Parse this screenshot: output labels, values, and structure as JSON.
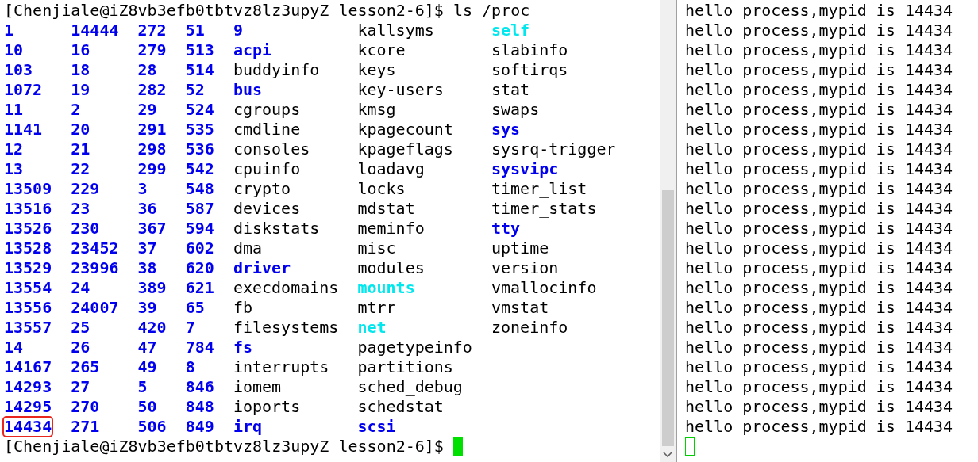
{
  "left_terminal": {
    "command_line": "[Chenjiale@iZ8vb3efb0tbtvz8lz3upyZ lesson2-6]$ ls /proc",
    "columns": [
      {
        "entries": [
          {
            "name": "1",
            "kind": "dir",
            "boxed": false
          },
          {
            "name": "10",
            "kind": "dir",
            "boxed": false
          },
          {
            "name": "103",
            "kind": "dir",
            "boxed": false
          },
          {
            "name": "1072",
            "kind": "dir",
            "boxed": false
          },
          {
            "name": "11",
            "kind": "dir",
            "boxed": false
          },
          {
            "name": "1141",
            "kind": "dir",
            "boxed": false
          },
          {
            "name": "12",
            "kind": "dir",
            "boxed": false
          },
          {
            "name": "13",
            "kind": "dir",
            "boxed": false
          },
          {
            "name": "13509",
            "kind": "dir",
            "boxed": false
          },
          {
            "name": "13516",
            "kind": "dir",
            "boxed": false
          },
          {
            "name": "13526",
            "kind": "dir",
            "boxed": false
          },
          {
            "name": "13528",
            "kind": "dir",
            "boxed": false
          },
          {
            "name": "13529",
            "kind": "dir",
            "boxed": false
          },
          {
            "name": "13554",
            "kind": "dir",
            "boxed": false
          },
          {
            "name": "13556",
            "kind": "dir",
            "boxed": false
          },
          {
            "name": "13557",
            "kind": "dir",
            "boxed": false
          },
          {
            "name": "14",
            "kind": "dir",
            "boxed": false
          },
          {
            "name": "14167",
            "kind": "dir",
            "boxed": false
          },
          {
            "name": "14293",
            "kind": "dir",
            "boxed": false
          },
          {
            "name": "14295",
            "kind": "dir",
            "boxed": false
          },
          {
            "name": "14434",
            "kind": "dir",
            "boxed": true
          }
        ]
      },
      {
        "entries": [
          {
            "name": "14444",
            "kind": "dir"
          },
          {
            "name": "16",
            "kind": "dir"
          },
          {
            "name": "18",
            "kind": "dir"
          },
          {
            "name": "19",
            "kind": "dir"
          },
          {
            "name": "2",
            "kind": "dir"
          },
          {
            "name": "20",
            "kind": "dir"
          },
          {
            "name": "21",
            "kind": "dir"
          },
          {
            "name": "22",
            "kind": "dir"
          },
          {
            "name": "229",
            "kind": "dir"
          },
          {
            "name": "23",
            "kind": "dir"
          },
          {
            "name": "230",
            "kind": "dir"
          },
          {
            "name": "23452",
            "kind": "dir"
          },
          {
            "name": "23996",
            "kind": "dir"
          },
          {
            "name": "24",
            "kind": "dir"
          },
          {
            "name": "24007",
            "kind": "dir"
          },
          {
            "name": "25",
            "kind": "dir"
          },
          {
            "name": "26",
            "kind": "dir"
          },
          {
            "name": "265",
            "kind": "dir"
          },
          {
            "name": "27",
            "kind": "dir"
          },
          {
            "name": "270",
            "kind": "dir"
          },
          {
            "name": "271",
            "kind": "dir"
          }
        ]
      },
      {
        "entries": [
          {
            "name": "272",
            "kind": "dir"
          },
          {
            "name": "279",
            "kind": "dir"
          },
          {
            "name": "28",
            "kind": "dir"
          },
          {
            "name": "282",
            "kind": "dir"
          },
          {
            "name": "29",
            "kind": "dir"
          },
          {
            "name": "291",
            "kind": "dir"
          },
          {
            "name": "298",
            "kind": "dir"
          },
          {
            "name": "299",
            "kind": "dir"
          },
          {
            "name": "3",
            "kind": "dir"
          },
          {
            "name": "36",
            "kind": "dir"
          },
          {
            "name": "367",
            "kind": "dir"
          },
          {
            "name": "37",
            "kind": "dir"
          },
          {
            "name": "38",
            "kind": "dir"
          },
          {
            "name": "389",
            "kind": "dir"
          },
          {
            "name": "39",
            "kind": "dir"
          },
          {
            "name": "420",
            "kind": "dir"
          },
          {
            "name": "47",
            "kind": "dir"
          },
          {
            "name": "49",
            "kind": "dir"
          },
          {
            "name": "5",
            "kind": "dir"
          },
          {
            "name": "50",
            "kind": "dir"
          },
          {
            "name": "506",
            "kind": "dir"
          }
        ]
      },
      {
        "entries": [
          {
            "name": "51",
            "kind": "dir"
          },
          {
            "name": "513",
            "kind": "dir"
          },
          {
            "name": "514",
            "kind": "dir"
          },
          {
            "name": "52",
            "kind": "dir"
          },
          {
            "name": "524",
            "kind": "dir"
          },
          {
            "name": "535",
            "kind": "dir"
          },
          {
            "name": "536",
            "kind": "dir"
          },
          {
            "name": "542",
            "kind": "dir"
          },
          {
            "name": "548",
            "kind": "dir"
          },
          {
            "name": "587",
            "kind": "dir"
          },
          {
            "name": "594",
            "kind": "dir"
          },
          {
            "name": "602",
            "kind": "dir"
          },
          {
            "name": "620",
            "kind": "dir"
          },
          {
            "name": "621",
            "kind": "dir"
          },
          {
            "name": "65",
            "kind": "dir"
          },
          {
            "name": "7",
            "kind": "dir"
          },
          {
            "name": "784",
            "kind": "dir"
          },
          {
            "name": "8",
            "kind": "dir"
          },
          {
            "name": "846",
            "kind": "dir"
          },
          {
            "name": "848",
            "kind": "dir"
          },
          {
            "name": "849",
            "kind": "dir"
          }
        ]
      },
      {
        "entries": [
          {
            "name": "9",
            "kind": "dir"
          },
          {
            "name": "acpi",
            "kind": "dir"
          },
          {
            "name": "buddyinfo",
            "kind": "file"
          },
          {
            "name": "bus",
            "kind": "dir"
          },
          {
            "name": "cgroups",
            "kind": "file"
          },
          {
            "name": "cmdline",
            "kind": "file"
          },
          {
            "name": "consoles",
            "kind": "file"
          },
          {
            "name": "cpuinfo",
            "kind": "file"
          },
          {
            "name": "crypto",
            "kind": "file"
          },
          {
            "name": "devices",
            "kind": "file"
          },
          {
            "name": "diskstats",
            "kind": "file"
          },
          {
            "name": "dma",
            "kind": "file"
          },
          {
            "name": "driver",
            "kind": "dir"
          },
          {
            "name": "execdomains",
            "kind": "file"
          },
          {
            "name": "fb",
            "kind": "file"
          },
          {
            "name": "filesystems",
            "kind": "file"
          },
          {
            "name": "fs",
            "kind": "dir"
          },
          {
            "name": "interrupts",
            "kind": "file"
          },
          {
            "name": "iomem",
            "kind": "file"
          },
          {
            "name": "ioports",
            "kind": "file"
          },
          {
            "name": "irq",
            "kind": "dir"
          }
        ]
      },
      {
        "entries": [
          {
            "name": "kallsyms",
            "kind": "file"
          },
          {
            "name": "kcore",
            "kind": "file"
          },
          {
            "name": "keys",
            "kind": "file"
          },
          {
            "name": "key-users",
            "kind": "file"
          },
          {
            "name": "kmsg",
            "kind": "file"
          },
          {
            "name": "kpagecount",
            "kind": "file"
          },
          {
            "name": "kpageflags",
            "kind": "file"
          },
          {
            "name": "loadavg",
            "kind": "file"
          },
          {
            "name": "locks",
            "kind": "file"
          },
          {
            "name": "mdstat",
            "kind": "file"
          },
          {
            "name": "meminfo",
            "kind": "file"
          },
          {
            "name": "misc",
            "kind": "file"
          },
          {
            "name": "modules",
            "kind": "file"
          },
          {
            "name": "mounts",
            "kind": "link"
          },
          {
            "name": "mtrr",
            "kind": "file"
          },
          {
            "name": "net",
            "kind": "link"
          },
          {
            "name": "pagetypeinfo",
            "kind": "file"
          },
          {
            "name": "partitions",
            "kind": "file"
          },
          {
            "name": "sched_debug",
            "kind": "file"
          },
          {
            "name": "schedstat",
            "kind": "file"
          },
          {
            "name": "scsi",
            "kind": "dir"
          }
        ]
      },
      {
        "entries": [
          {
            "name": "self",
            "kind": "link"
          },
          {
            "name": "slabinfo",
            "kind": "file"
          },
          {
            "name": "softirqs",
            "kind": "file"
          },
          {
            "name": "stat",
            "kind": "file"
          },
          {
            "name": "swaps",
            "kind": "file"
          },
          {
            "name": "sys",
            "kind": "dir"
          },
          {
            "name": "sysrq-trigger",
            "kind": "file"
          },
          {
            "name": "sysvipc",
            "kind": "dir"
          },
          {
            "name": "timer_list",
            "kind": "file"
          },
          {
            "name": "timer_stats",
            "kind": "file"
          },
          {
            "name": "tty",
            "kind": "dir"
          },
          {
            "name": "uptime",
            "kind": "file"
          },
          {
            "name": "version",
            "kind": "file"
          },
          {
            "name": "vmallocinfo",
            "kind": "file"
          },
          {
            "name": "vmstat",
            "kind": "file"
          },
          {
            "name": "zoneinfo",
            "kind": "file"
          }
        ]
      }
    ],
    "prompt": "[Chenjiale@iZ8vb3efb0tbtvz8lz3upyZ lesson2-6]$",
    "cursor": {
      "focused": true
    }
  },
  "right_terminal": {
    "lines": [
      "hello process,mypid is 14434",
      "hello process,mypid is 14434",
      "hello process,mypid is 14434",
      "hello process,mypid is 14434",
      "hello process,mypid is 14434",
      "hello process,mypid is 14434",
      "hello process,mypid is 14434",
      "hello process,mypid is 14434",
      "hello process,mypid is 14434",
      "hello process,mypid is 14434",
      "hello process,mypid is 14434",
      "hello process,mypid is 14434",
      "hello process,mypid is 14434",
      "hello process,mypid is 14434",
      "hello process,mypid is 14434",
      "hello process,mypid is 14434",
      "hello process,mypid is 14434",
      "hello process,mypid is 14434",
      "hello process,mypid is 14434",
      "hello process,mypid is 14434",
      "hello process,mypid is 14434",
      "hello process,mypid is 14434"
    ],
    "cursor": {
      "focused": false
    }
  }
}
